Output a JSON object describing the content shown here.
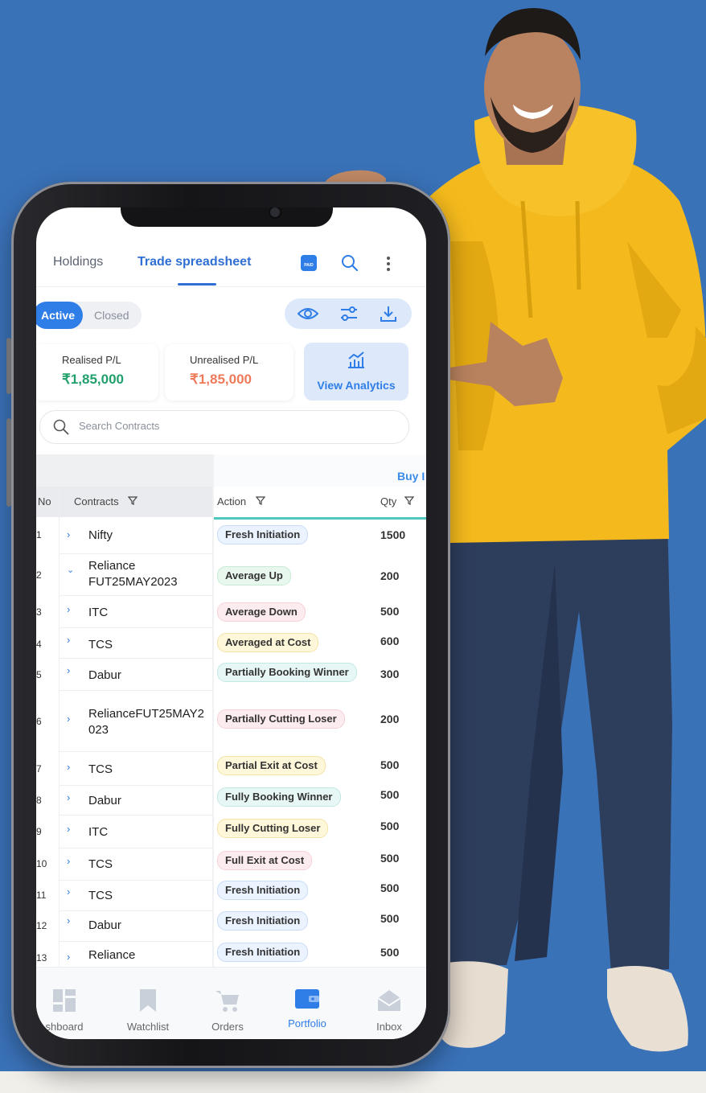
{
  "header": {
    "tabs": [
      {
        "label": "Holdings",
        "active": false
      },
      {
        "label": "Trade spreadsheet",
        "active": true
      }
    ],
    "icons": [
      "pa-badge-icon",
      "search-icon",
      "more-vertical-icon"
    ],
    "pa_badge": "PA/D"
  },
  "filter": {
    "active_label": "Active",
    "closed_label": "Closed",
    "tools": [
      "eye-icon",
      "sliders-icon",
      "download-icon"
    ]
  },
  "summary": {
    "realised_label": "Realised P/L",
    "realised_value": "₹1,85,000",
    "unrealised_label": "Unrealised P/L",
    "unrealised_value": "₹1,85,000",
    "analytics_label": "View Analytics",
    "colors": {
      "profit": "#22a06b",
      "loss": "#ef7a5a",
      "accent": "#2f7de6"
    }
  },
  "search": {
    "placeholder": "Search Contracts"
  },
  "table": {
    "group_label": "Buy I",
    "columns": [
      "No",
      "Contracts",
      "Action",
      "Qty"
    ],
    "rows": [
      {
        "no": "1",
        "contract": "Nifty",
        "action": "Fresh Initiation",
        "qty": "1500",
        "expanded": false
      },
      {
        "no": "2",
        "contract": "Reliance FUT25MAY2023",
        "action": "Average Up",
        "qty": "200",
        "expanded": true
      },
      {
        "no": "3",
        "contract": "ITC",
        "action": "Average Down",
        "qty": "500",
        "expanded": false
      },
      {
        "no": "4",
        "contract": "TCS",
        "action": "Averaged at Cost",
        "qty": "600",
        "expanded": false
      },
      {
        "no": "5",
        "contract": "Dabur",
        "action": "Partially Booking Winner",
        "qty": "300",
        "expanded": false
      },
      {
        "no": "6",
        "contract": "RelianceFUT25MAY2023",
        "action": "Partially Cutting Loser",
        "qty": "200",
        "expanded": false
      },
      {
        "no": "7",
        "contract": "TCS",
        "action": "Partial Exit at Cost",
        "qty": "500",
        "expanded": false
      },
      {
        "no": "8",
        "contract": "Dabur",
        "action": "Fully Booking Winner",
        "qty": "500",
        "expanded": false
      },
      {
        "no": "9",
        "contract": "ITC",
        "action": "Fully Cutting Loser",
        "qty": "500",
        "expanded": false
      },
      {
        "no": "10",
        "contract": "TCS",
        "action": "Full Exit at Cost",
        "qty": "500",
        "expanded": false
      },
      {
        "no": "11",
        "contract": "TCS",
        "action": "Fresh Initiation",
        "qty": "500",
        "expanded": false
      },
      {
        "no": "12",
        "contract": "Dabur",
        "action": "Fresh Initiation",
        "qty": "500",
        "expanded": false
      },
      {
        "no": "13",
        "contract": "Reliance",
        "action": "Fresh Initiation",
        "qty": "500",
        "expanded": false
      }
    ]
  },
  "bottom_nav": [
    {
      "label": "shboard",
      "icon": "dashboard-icon",
      "active": false
    },
    {
      "label": "Watchlist",
      "icon": "bookmark-icon",
      "active": false
    },
    {
      "label": "Orders",
      "icon": "cart-icon",
      "active": false
    },
    {
      "label": "Portfolio",
      "icon": "wallet-icon",
      "active": true
    },
    {
      "label": "Inbox",
      "icon": "inbox-icon",
      "active": false
    }
  ]
}
